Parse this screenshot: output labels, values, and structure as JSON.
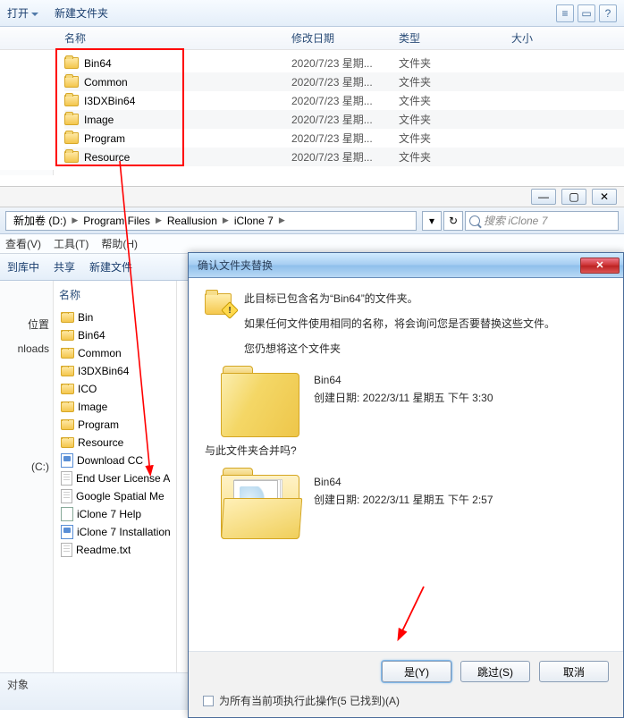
{
  "top": {
    "toolbar": {
      "open": "打开",
      "newfolder": "新建文件夹"
    },
    "columns": {
      "name": "名称",
      "date": "修改日期",
      "type": "类型",
      "size": "大小"
    },
    "items": [
      {
        "name": "Bin64",
        "date": "2020/7/23 星期...",
        "type": "文件夹"
      },
      {
        "name": "Common",
        "date": "2020/7/23 星期...",
        "type": "文件夹"
      },
      {
        "name": "I3DXBin64",
        "date": "2020/7/23 星期...",
        "type": "文件夹"
      },
      {
        "name": "Image",
        "date": "2020/7/23 星期...",
        "type": "文件夹"
      },
      {
        "name": "Program",
        "date": "2020/7/23 星期...",
        "type": "文件夹"
      },
      {
        "name": "Resource",
        "date": "2020/7/23 星期...",
        "type": "文件夹"
      }
    ],
    "sidebar": {
      "loc": "位置",
      "dl": "nloads"
    }
  },
  "addr": {
    "segments": [
      "新加卷 (D:)",
      "Program Files",
      "Reallusion",
      "iClone 7"
    ],
    "search_ph": "搜索 iClone 7"
  },
  "menu": {
    "view": "查看(V)",
    "tools": "工具(T)",
    "help": "帮助(H)"
  },
  "tb2": {
    "lib": "到库中",
    "share": "共享",
    "newf": "新建文件"
  },
  "tree": {
    "header": "名称",
    "sidebar": {
      "loc": "位置",
      "dl": "nloads",
      "vol": "(C:)"
    },
    "items": [
      {
        "k": "folder",
        "n": "Bin"
      },
      {
        "k": "folder",
        "n": "Bin64"
      },
      {
        "k": "folder",
        "n": "Common"
      },
      {
        "k": "folder",
        "n": "I3DXBin64"
      },
      {
        "k": "folder",
        "n": "ICO"
      },
      {
        "k": "folder",
        "n": "Image"
      },
      {
        "k": "folder",
        "n": "Program"
      },
      {
        "k": "folder",
        "n": "Resource"
      },
      {
        "k": "html",
        "n": "Download CC"
      },
      {
        "k": "file",
        "n": "End User License A"
      },
      {
        "k": "file",
        "n": "Google Spatial Me"
      },
      {
        "k": "chm",
        "n": "iClone 7 Help"
      },
      {
        "k": "html",
        "n": "iClone 7 Installation"
      },
      {
        "k": "file",
        "n": "Readme.txt"
      }
    ]
  },
  "status": {
    "text": "对象"
  },
  "dialog": {
    "title": "确认文件夹替换",
    "line1": "此目标已包含名为“Bin64”的文件夹。",
    "line2": "如果任何文件使用相同的名称，将会询问您是否要替换这些文件。",
    "q1": "您仍想将这个文件夹",
    "dest": {
      "name": "Bin64",
      "meta": "创建日期: 2022/3/11 星期五 下午 3:30"
    },
    "q2": "与此文件夹合并吗?",
    "src": {
      "name": "Bin64",
      "meta": "创建日期: 2022/3/11 星期五 下午 2:57"
    },
    "buttons": {
      "yes": "是(Y)",
      "skip": "跳过(S)",
      "cancel": "取消"
    },
    "check": "为所有当前项执行此操作(5 已找到)(A)"
  }
}
